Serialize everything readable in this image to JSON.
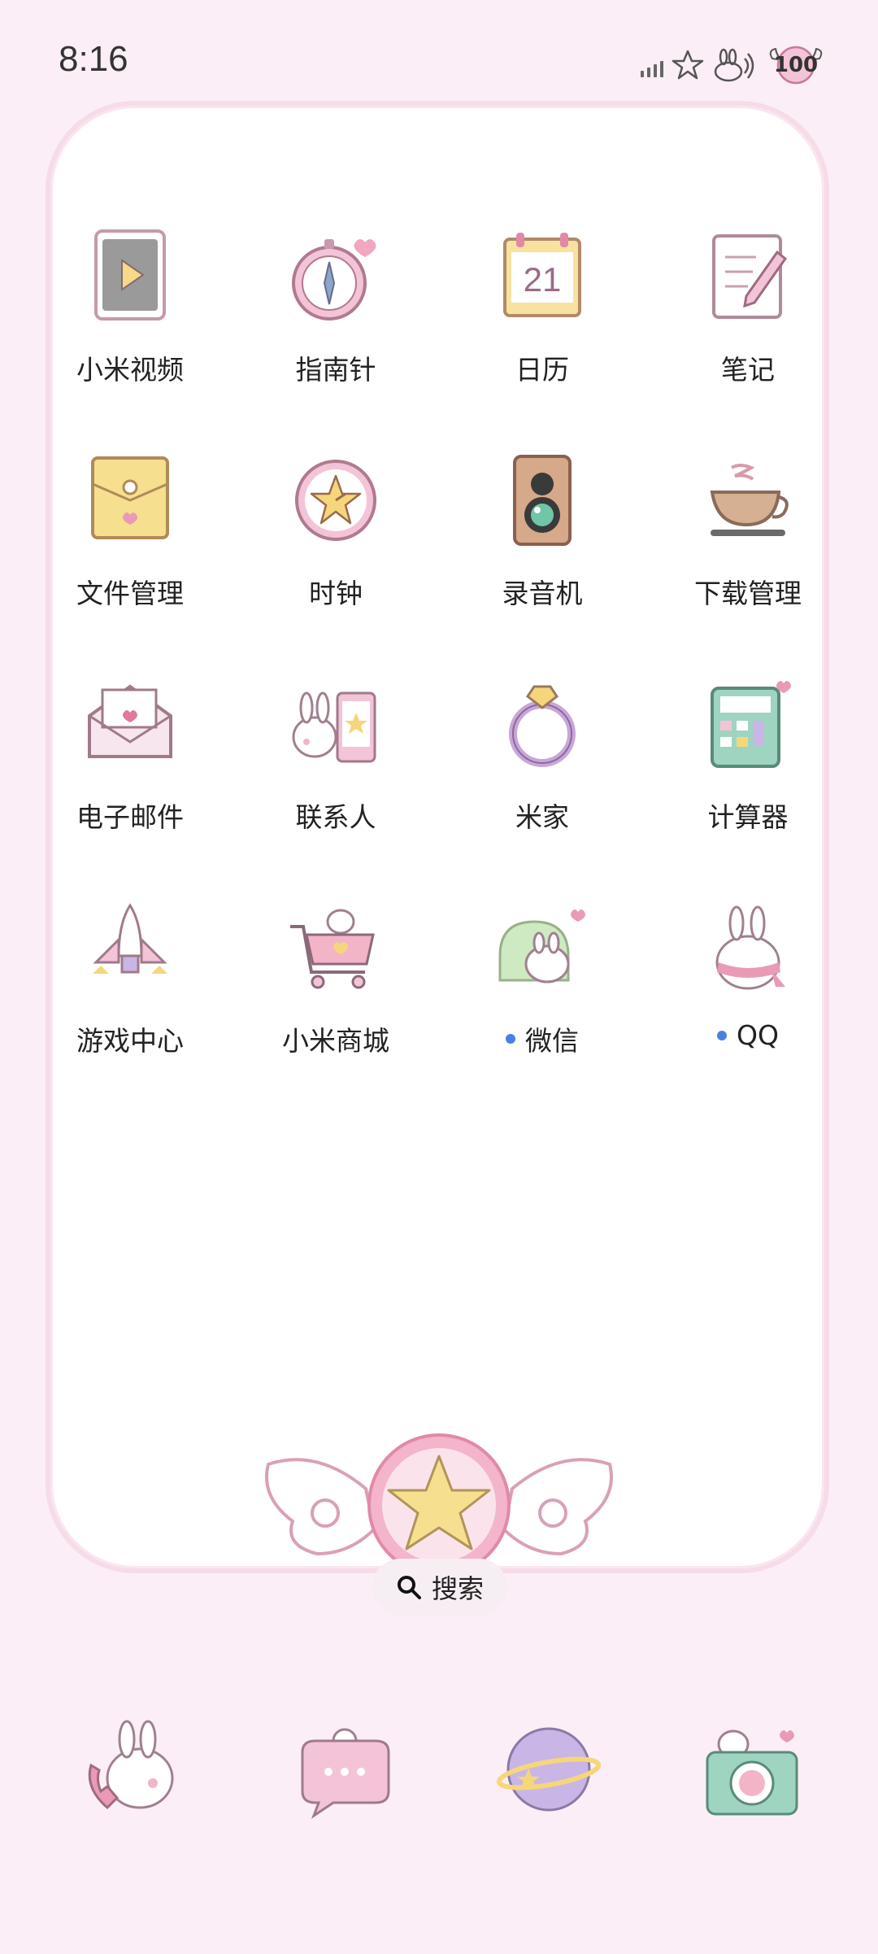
{
  "status_bar": {
    "time": "8:16",
    "battery": "100",
    "icons": [
      "signal-icon",
      "star-icon",
      "bunny-wifi-icon",
      "battery-icon"
    ]
  },
  "apps": [
    {
      "label": "小米视频",
      "icon": "video-player-icon",
      "dot": false
    },
    {
      "label": "指南针",
      "icon": "compass-icon",
      "dot": false
    },
    {
      "label": "日历",
      "icon": "calendar-icon",
      "day": "21",
      "dot": false
    },
    {
      "label": "笔记",
      "icon": "notes-icon",
      "dot": false
    },
    {
      "label": "文件管理",
      "icon": "folder-envelope-icon",
      "dot": false
    },
    {
      "label": "时钟",
      "icon": "clock-icon",
      "dot": false
    },
    {
      "label": "录音机",
      "icon": "recorder-icon",
      "dot": false
    },
    {
      "label": "下载管理",
      "icon": "coffee-cup-icon",
      "dot": false
    },
    {
      "label": "电子邮件",
      "icon": "mail-icon",
      "dot": false
    },
    {
      "label": "联系人",
      "icon": "bunny-phone-icon",
      "dot": false
    },
    {
      "label": "米家",
      "icon": "ring-icon",
      "dot": false
    },
    {
      "label": "计算器",
      "icon": "calculator-icon",
      "dot": false
    },
    {
      "label": "游戏中心",
      "icon": "rocket-icon",
      "dot": false
    },
    {
      "label": "小米商城",
      "icon": "shopping-cart-icon",
      "dot": false
    },
    {
      "label": "微信",
      "icon": "bunny-chat-icon",
      "dot": true
    },
    {
      "label": "QQ",
      "icon": "bunny-scarf-icon",
      "dot": true
    }
  ],
  "search": {
    "label": "搜索",
    "icon": "search-icon"
  },
  "dock": [
    {
      "icon": "bunny-phone-call-icon"
    },
    {
      "icon": "bunny-message-icon"
    },
    {
      "icon": "planet-browser-icon"
    },
    {
      "icon": "bunny-camera-icon"
    }
  ],
  "colors": {
    "background": "#fbeef6",
    "card": "#ffffff",
    "card_border": "#f6dbe9",
    "accent_pink": "#e9a3c2",
    "dot_blue": "#4b7fe0"
  }
}
